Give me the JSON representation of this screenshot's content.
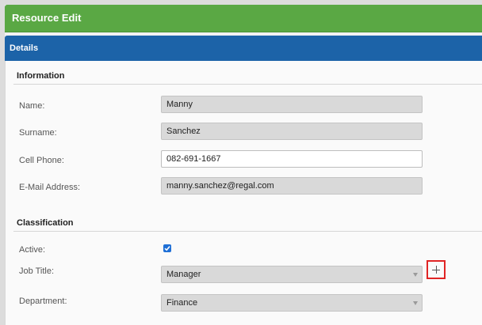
{
  "header": {
    "title": "Resource Edit"
  },
  "details": {
    "title": "Details"
  },
  "information": {
    "title": "Information",
    "name_label": "Name:",
    "name_value": "Manny",
    "surname_label": "Surname:",
    "surname_value": "Sanchez",
    "cell_label": "Cell Phone:",
    "cell_value": "082-691-1667",
    "email_label": "E-Mail Address:",
    "email_value": "manny.sanchez@regal.com"
  },
  "classification": {
    "title": "Classification",
    "active_label": "Active:",
    "active_checked": true,
    "job_title_label": "Job Title:",
    "job_title_value": "Manager",
    "department_label": "Department:",
    "department_value": "Finance",
    "add_icon": "plus-icon"
  },
  "colors": {
    "green_header": "#5aa844",
    "blue_header": "#1c63a8",
    "checkbox": "#1f6fd6",
    "add_button_border": "#e02424"
  }
}
